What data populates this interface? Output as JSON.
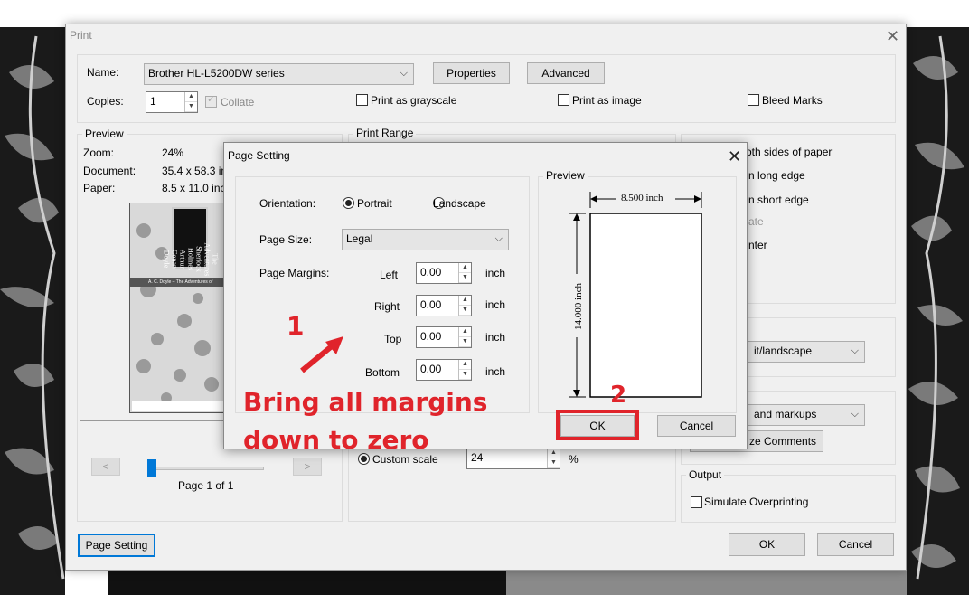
{
  "print": {
    "title": "Print",
    "name_label": "Name:",
    "printer": "Brother HL-L5200DW series",
    "properties_label": "Properties",
    "advanced_label": "Advanced",
    "copies_label": "Copies:",
    "copies_value": "1",
    "collate_label": "Collate",
    "grayscale_label": "Print as grayscale",
    "image_label": "Print as image",
    "bleed_label": "Bleed Marks",
    "preview": {
      "title": "Preview",
      "zoom_label": "Zoom:",
      "zoom_value": "24%",
      "document_label": "Document:",
      "document_value": "35.4 x 58.3 in",
      "paper_label": "Paper:",
      "paper_value": "8.5 x 11.0 inch",
      "page_label": "Page 1 of 1",
      "thumb_title_1": "The Adventures",
      "thumb_title_2": "Sherlock Holmes",
      "thumb_title_3": "Arthur Conan Doyle",
      "thumb_caption": "A. C. Doyle – The Adventures of"
    },
    "print_range_title": "Print Range",
    "duplex_text": "oth sides of paper",
    "long_edge_text": "n long edge",
    "short_edge_text": "n short edge",
    "rotate_text": "ate",
    "center_text": "nter",
    "orientation_combo": "it/landscape",
    "markups_combo": "and markups",
    "comments_btn": "ze Comments",
    "custom_scale_label": "Custom scale",
    "custom_scale_value": "24",
    "percent_sign": "%",
    "output_title": "Output",
    "overprint_label": "Simulate Overprinting",
    "page_setting_label": "Page Setting",
    "ok_label": "OK",
    "cancel_label": "Cancel"
  },
  "page_setting": {
    "title": "Page Setting",
    "orientation_label": "Orientation:",
    "portrait_label": "Portrait",
    "landscape_label": "Landscape",
    "page_size_label": "Page Size:",
    "page_size_value": "Legal",
    "page_margins_label": "Page Margins:",
    "left_label": "Left",
    "right_label": "Right",
    "top_label": "Top",
    "bottom_label": "Bottom",
    "left_value": "0.00",
    "right_value": "0.00",
    "top_value": "0.00",
    "bottom_value": "0.00",
    "unit": "inch",
    "preview_title": "Preview",
    "width_dim": "8.500 inch",
    "height_dim": "14.000 inch",
    "ok_label": "OK",
    "cancel_label": "Cancel"
  },
  "annotations": {
    "step1": "1",
    "step2": "2",
    "line1": "Bring all margins",
    "line2": "down to zero",
    "color": "#e0242b"
  }
}
